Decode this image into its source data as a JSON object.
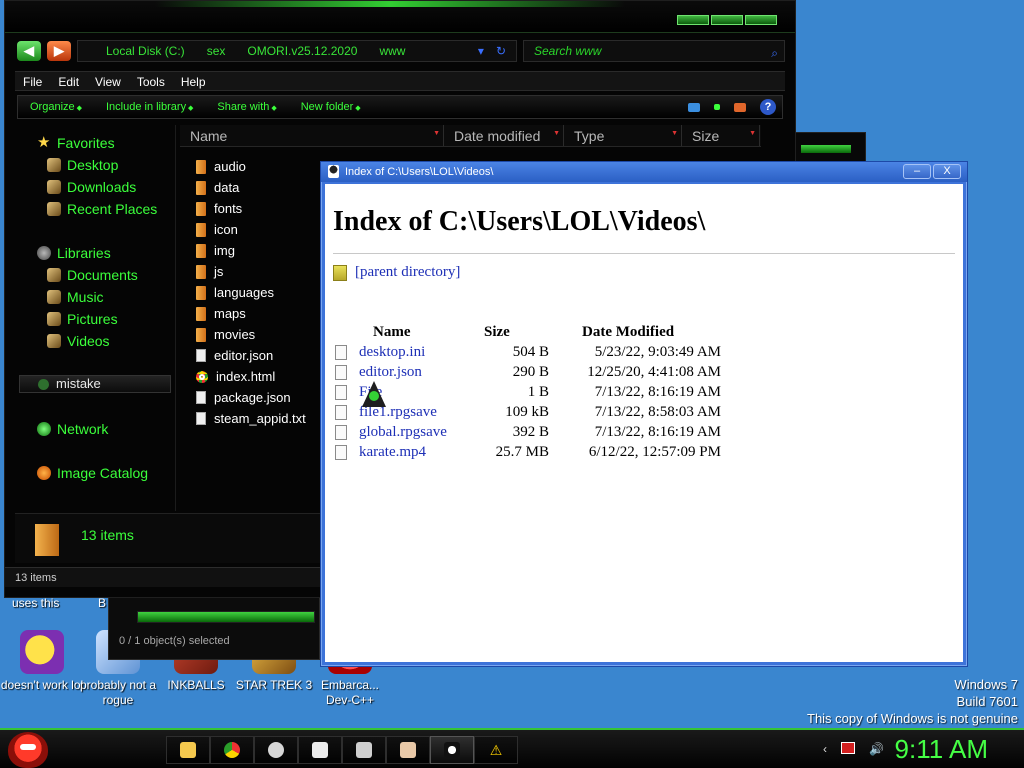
{
  "explorer": {
    "address": [
      "Local Disk (C:)",
      "sex",
      "OMORI.v25.12.2020",
      "www"
    ],
    "search_placeholder": "Search www",
    "menu": [
      "File",
      "Edit",
      "View",
      "Tools",
      "Help"
    ],
    "commands": [
      "Organize",
      "Include in library",
      "Share with",
      "New folder"
    ],
    "nav": {
      "favorites": "Favorites",
      "fav_items": [
        "Desktop",
        "Downloads",
        "Recent Places"
      ],
      "libraries": "Libraries",
      "lib_items": [
        "Documents",
        "Music",
        "Pictures",
        "Videos"
      ],
      "homegroup": "mistake",
      "network": "Network",
      "image_catalog": "Image Catalog"
    },
    "columns": [
      "Name",
      "Date modified",
      "Type",
      "Size"
    ],
    "files": [
      "audio",
      "data",
      "fonts",
      "icon",
      "img",
      "js",
      "languages",
      "maps",
      "movies",
      "editor.json",
      "index.html",
      "package.json",
      "steam_appid.txt"
    ],
    "details_count": "13 items",
    "status_count": "13 items"
  },
  "back_window": {
    "selection": "0 / 1 object(s) selected"
  },
  "index_window": {
    "title": "Index of C:\\Users\\LOL\\Videos\\",
    "heading": "Index of C:\\Users\\LOL\\Videos\\",
    "parent_link": "[parent directory]",
    "headers": [
      "Name",
      "Size",
      "Date Modified"
    ],
    "rows": [
      {
        "name": "desktop.ini",
        "size": "504 B",
        "date": "5/23/22, 9:03:49 AM"
      },
      {
        "name": "editor.json",
        "size": "290 B",
        "date": "12/25/20, 4:41:08 AM"
      },
      {
        "name": "File",
        "size": "1 B",
        "date": "7/13/22, 8:16:19 AM"
      },
      {
        "name": "file1.rpgsave",
        "size": "109 kB",
        "date": "7/13/22, 8:58:03 AM"
      },
      {
        "name": "global.rpgsave",
        "size": "392 B",
        "date": "7/13/22, 8:16:19 AM"
      },
      {
        "name": "karate.mp4",
        "size": "25.7 MB",
        "date": "6/12/22, 12:57:09 PM"
      }
    ],
    "min_label": "–",
    "close_label": "X"
  },
  "desktop": {
    "partial_labels": [
      "uses this",
      "B"
    ],
    "icons": [
      {
        "label": "doesn't work lol",
        "icon": "yahoo-messenger-icon"
      },
      {
        "label": "probably not a rogue",
        "icon": "shortcut-icon"
      },
      {
        "label": "INKBALLS",
        "icon": "inkballs-icon"
      },
      {
        "label": "STAR TREK 3",
        "icon": "star-trek-icon"
      },
      {
        "label": "Embarca... Dev-C++",
        "icon": "dev-cpp-icon"
      }
    ]
  },
  "watermark": {
    "line1": "Windows 7",
    "line2": "Build 7601",
    "line3": "This copy of Windows is not genuine"
  },
  "taskbar": {
    "clock": "9:11 AM"
  }
}
